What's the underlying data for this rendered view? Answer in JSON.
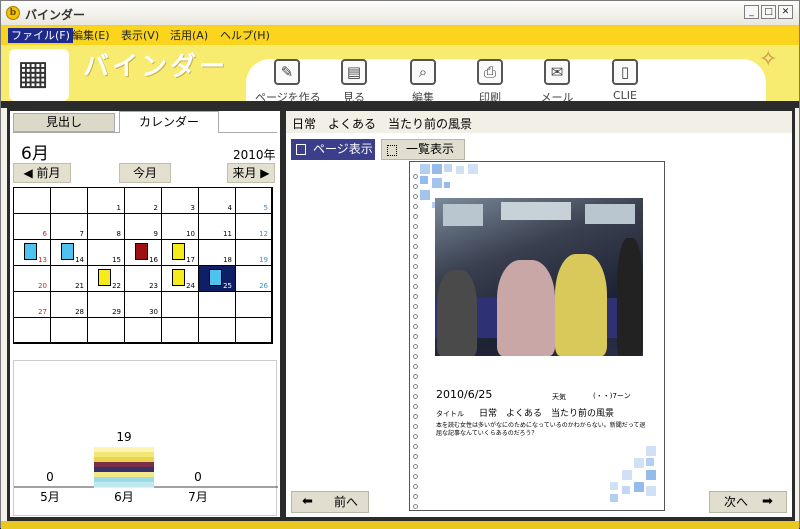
{
  "window": {
    "title": "バインダー"
  },
  "menu": [
    "ファイル(F)",
    "編集(E)",
    "表示(V)",
    "活用(A)",
    "ヘルプ(H)"
  ],
  "app_name": "バインダー",
  "toolbar": [
    {
      "label": "ページを作る",
      "icon": "pencil-page-icon"
    },
    {
      "label": "見る",
      "icon": "open-book-icon"
    },
    {
      "label": "編集",
      "icon": "magnify-page-icon"
    },
    {
      "label": "印刷",
      "icon": "printer-icon"
    },
    {
      "label": "メール",
      "icon": "paperclip-mail-icon"
    },
    {
      "label": "CLIE",
      "icon": "pda-icon"
    }
  ],
  "tabs": {
    "midashi": "見出し",
    "calendar": "カレンダー"
  },
  "calendar": {
    "month": "6月",
    "year": "2010年",
    "prev": "前月",
    "today": "今月",
    "next": "来月",
    "weeks": [
      [
        {
          "d": ""
        },
        {
          "d": ""
        },
        {
          "d": "1"
        },
        {
          "d": "2"
        },
        {
          "d": "3"
        },
        {
          "d": "4"
        },
        {
          "d": "5"
        }
      ],
      [
        {
          "d": "6"
        },
        {
          "d": "7"
        },
        {
          "d": "8"
        },
        {
          "d": "9"
        },
        {
          "d": "10"
        },
        {
          "d": "11"
        },
        {
          "d": "12"
        }
      ],
      [
        {
          "d": "13",
          "note": "#4fc3ef"
        },
        {
          "d": "14",
          "note": "#4fc3ef"
        },
        {
          "d": "15"
        },
        {
          "d": "16",
          "note": "#a01010"
        },
        {
          "d": "17",
          "note": "#f5ea1a"
        },
        {
          "d": "18"
        },
        {
          "d": "19"
        }
      ],
      [
        {
          "d": "20"
        },
        {
          "d": "21"
        },
        {
          "d": "22",
          "note": "#f5ea1a"
        },
        {
          "d": "23"
        },
        {
          "d": "24",
          "note": "#f5ea1a"
        },
        {
          "d": "25",
          "note": "#4fc3ef",
          "selected": true
        },
        {
          "d": "26"
        }
      ],
      [
        {
          "d": "27"
        },
        {
          "d": "28"
        },
        {
          "d": "29"
        },
        {
          "d": "30"
        },
        {
          "d": ""
        },
        {
          "d": ""
        },
        {
          "d": ""
        }
      ],
      [
        {
          "d": ""
        },
        {
          "d": ""
        },
        {
          "d": ""
        },
        {
          "d": ""
        },
        {
          "d": ""
        },
        {
          "d": ""
        },
        {
          "d": ""
        }
      ]
    ],
    "sunday_color": "#d42020",
    "saturday_color": "#2b9ad6"
  },
  "chart_data": {
    "type": "bar",
    "categories": [
      "5月",
      "6月",
      "7月"
    ],
    "values": [
      0,
      19,
      0
    ],
    "stripe_colors": [
      "#fdf6b0",
      "#f5e777",
      "#e8d54a",
      "#7b2d4a",
      "#3b2f6a",
      "#f1e98a",
      "#9adbe4",
      "#bfe9ee"
    ]
  },
  "document": {
    "title": "日常　よくある　当たり前の風景",
    "views": {
      "page": "ページ表示",
      "list": "一覧表示"
    },
    "page": {
      "date": "2010/6/25",
      "weather_label": "天気",
      "weather": "(・・)7ーン",
      "title_label": "タイトル",
      "title": "日常　よくある　当たり前の風景",
      "body": "本を読む女性は多いがなにのためになっているのかわからない。新聞だって退屈な記事なんていくらあるのだろう？"
    },
    "prev": "前へ",
    "next": "次へ"
  }
}
